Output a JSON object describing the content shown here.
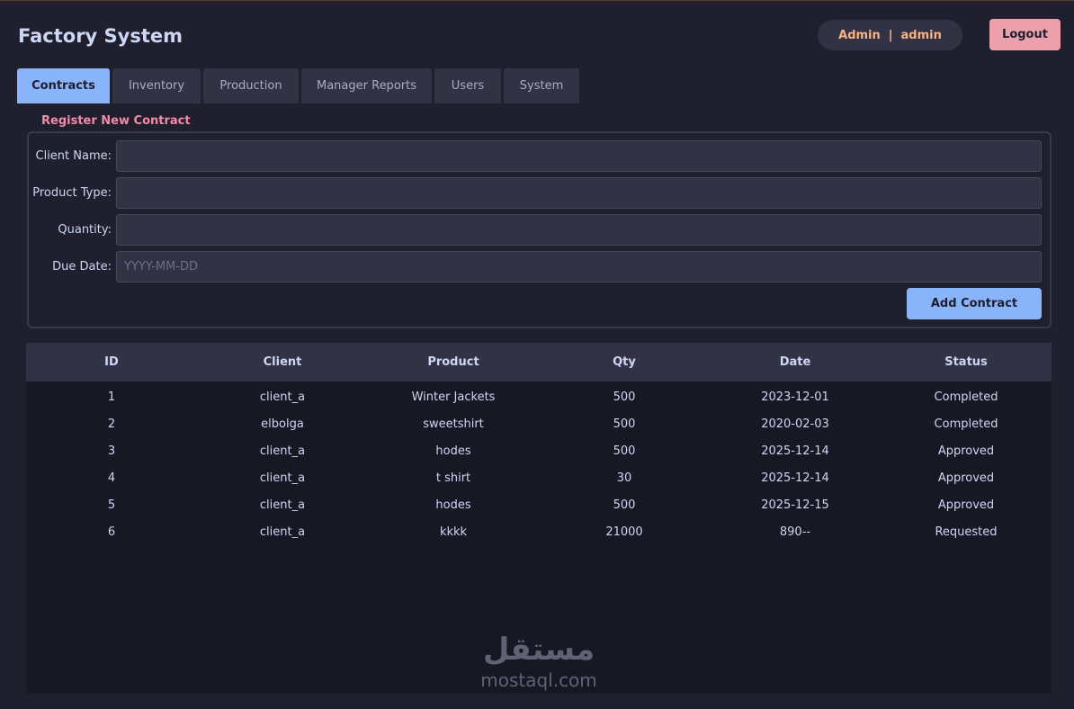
{
  "header": {
    "title": "Factory System",
    "user_role": "Admin",
    "user_separator": "|",
    "user_name": "admin",
    "logout_label": "Logout"
  },
  "tabs": [
    {
      "label": "Contracts",
      "active": true
    },
    {
      "label": "Inventory",
      "active": false
    },
    {
      "label": "Production",
      "active": false
    },
    {
      "label": "Manager Reports",
      "active": false
    },
    {
      "label": "Users",
      "active": false
    },
    {
      "label": "System",
      "active": false
    }
  ],
  "form": {
    "section_title": "Register New Contract",
    "client_name_label": "Client Name:",
    "client_name_value": "",
    "product_type_label": "Product Type:",
    "product_type_value": "",
    "quantity_label": "Quantity:",
    "quantity_value": "",
    "due_date_label": "Due Date:",
    "due_date_value": "",
    "due_date_placeholder": "YYYY-MM-DD",
    "add_label": "Add Contract"
  },
  "table": {
    "headers": [
      "ID",
      "Client",
      "Product",
      "Qty",
      "Date",
      "Status"
    ],
    "rows": [
      [
        "1",
        "client_a",
        "Winter Jackets",
        "500",
        "2023-12-01",
        "Completed"
      ],
      [
        "2",
        "elbolga",
        "sweetshirt",
        "500",
        "2020-02-03",
        "Completed"
      ],
      [
        "3",
        "client_a",
        "hodes",
        "500",
        "2025-12-14",
        "Approved"
      ],
      [
        "4",
        "client_a",
        "t shirt",
        "30",
        "2025-12-14",
        "Approved"
      ],
      [
        "5",
        "client_a",
        "hodes",
        "500",
        "2025-12-15",
        "Approved"
      ],
      [
        "6",
        "client_a",
        "kkkk",
        "21000",
        "890--",
        "Requested"
      ]
    ]
  },
  "watermark": {
    "arabic": "مستقل",
    "latin": "mostaql.com"
  },
  "colors": {
    "background": "#1f1f2e",
    "accent_blue": "#89b4fa",
    "accent_pink": "#eba0ac",
    "section_title": "#f38ba8",
    "user_text": "#fab387"
  }
}
